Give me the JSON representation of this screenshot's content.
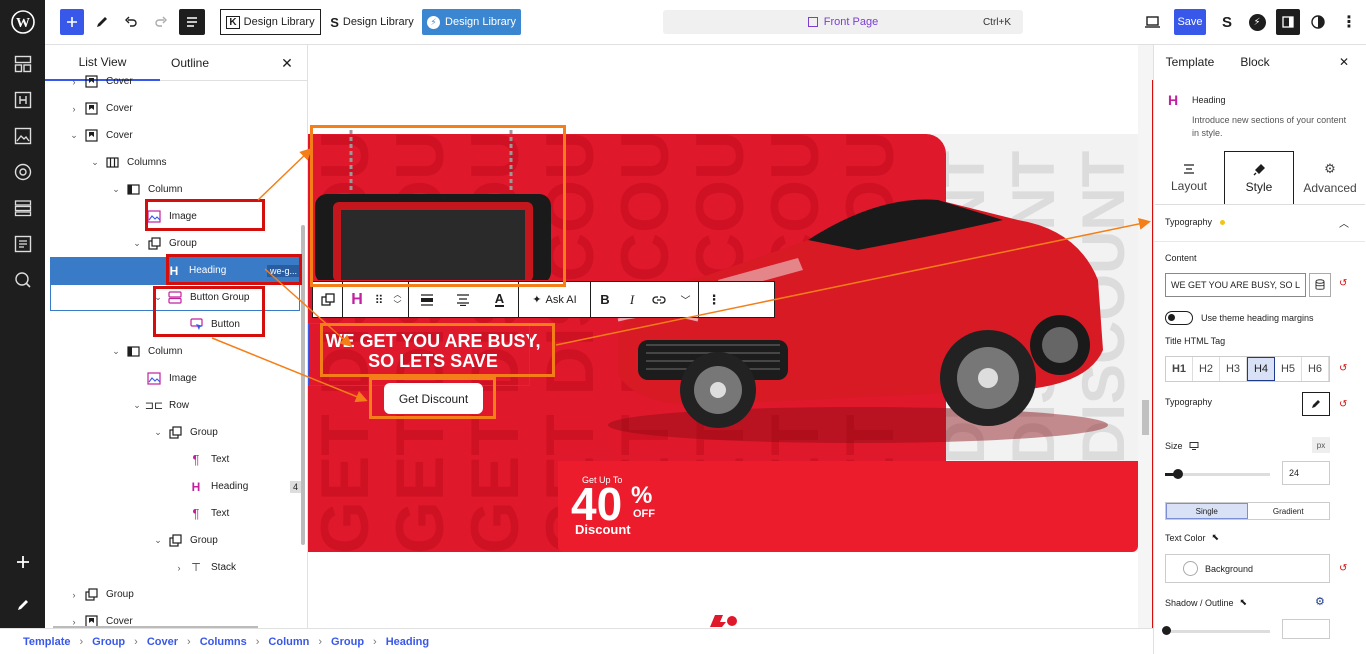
{
  "topbar": {
    "pattern1": "Design Library",
    "pattern2": "Design Library",
    "pattern3": "Design Library",
    "doc_title": "Front Page",
    "shortcut": "Ctrl+K",
    "save": "Save"
  },
  "listview": {
    "tab_list": "List View",
    "tab_outline": "Outline",
    "rows": [
      {
        "label": "Cover"
      },
      {
        "label": "Cover"
      },
      {
        "label": "Cover"
      },
      {
        "label": "Columns"
      },
      {
        "label": "Column"
      },
      {
        "label": "Image"
      },
      {
        "label": "Group"
      },
      {
        "label": "Heading",
        "tag": "we-g..."
      },
      {
        "label": "Button Group"
      },
      {
        "label": "Button"
      },
      {
        "label": "Column"
      },
      {
        "label": "Image"
      },
      {
        "label": "Row"
      },
      {
        "label": "Group"
      },
      {
        "label": "Text"
      },
      {
        "label": "Heading",
        "badge": "4"
      },
      {
        "label": "Text"
      },
      {
        "label": "Group"
      },
      {
        "label": "Stack"
      },
      {
        "label": "Group"
      },
      {
        "label": "Cover"
      }
    ]
  },
  "canvas": {
    "headline_line1": "WE GET YOU ARE BUSY,",
    "headline_line2": "SO LETS SAVE",
    "cta": "Get Discount",
    "ask_ai": "Ask AI",
    "promo": {
      "small": "Get Up To",
      "big": "40",
      "pct": "%",
      "off": "OFF",
      "label": "Discount"
    }
  },
  "inspector": {
    "tab_template": "Template",
    "tab_block": "Block",
    "block_name": "Heading",
    "block_desc": "Introduce new sections of your content in style.",
    "tabs": [
      "Layout",
      "Style",
      "Advanced"
    ],
    "section": "Typography",
    "content_label": "Content",
    "content_value": "WE GET YOU ARE BUSY, SO L",
    "theme_margins": "Use theme heading margins",
    "html_tag_label": "Title HTML Tag",
    "tags": [
      "H1",
      "H2",
      "H3",
      "H4",
      "H5",
      "H6"
    ],
    "selected_tag": "H4",
    "typography_label": "Typography",
    "size_label": "Size",
    "size_unit": "px",
    "size_value": "24",
    "size_fraction": 0.12,
    "color_modes": [
      "Single",
      "Gradient"
    ],
    "text_color_label": "Text Color",
    "background_label": "Background",
    "shadow_label": "Shadow / Outline"
  },
  "breadcrumb": [
    "Template",
    "Group",
    "Cover",
    "Columns",
    "Column",
    "Group",
    "Heading"
  ],
  "colors": {
    "accent": "#3858e9",
    "wp_dark": "#1e1e1e",
    "highlight_red": "#d40d0d",
    "arrow_orange": "#f47e17",
    "banner_red": "#e0182c",
    "promo_red": "#ec1c2d"
  }
}
